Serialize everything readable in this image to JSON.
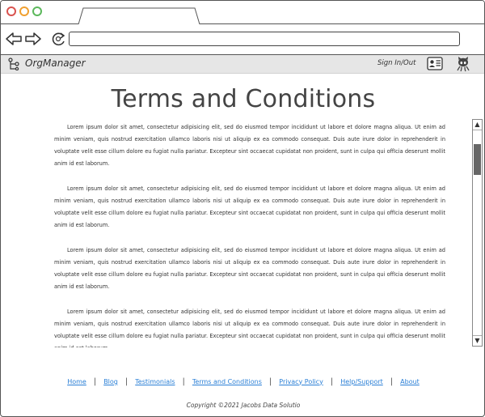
{
  "browser": {
    "url_value": "",
    "window_buttons": [
      "close",
      "minimize",
      "maximize"
    ]
  },
  "app": {
    "title": "OrgManager",
    "sign_in_label": "Sign In/Out",
    "icons": {
      "logo": "org-tree-icon",
      "profile": "id-card-icon",
      "repo": "octocat-icon"
    }
  },
  "page": {
    "title": "Terms and Conditions",
    "paragraphs": [
      "Lorem ipsum dolor sit amet, consectetur adipisicing elit, sed do eiusmod tempor incididunt ut labore et dolore magna aliqua. Ut enim ad minim veniam, quis nostrud exercitation ullamco laboris nisi ut aliquip ex ea commodo consequat. Duis aute irure dolor in reprehenderit in voluptate velit esse cillum dolore eu fugiat nulla pariatur. Excepteur sint occaecat cupidatat non proident, sunt in culpa qui offIcia deserunt mollit anim id est laborum.",
      "Lorem ipsum dolor sit amet, consectetur adipisicing elit, sed do eiusmod tempor incididunt ut labore et dolore magna aliqua. Ut enim ad minim veniam, quis nostrud exercitation ullamco laboris nisi ut aliquip ex ea commodo consequat. Duis aute irure dolor in reprehenderit in voluptate velit esse cillum dolore eu fugiat nulla pariatur. Excepteur sint occaecat cupidatat non proident, sunt in culpa qui offIcia deserunt mollit anim id est laborum.",
      "Lorem ipsum dolor sit amet, consectetur adipisicing elit, sed do eiusmod tempor incididunt ut labore et dolore magna aliqua. Ut enim ad minim veniam, quis nostrud exercitation ullamco laboris nisi ut aliquip ex ea commodo consequat. Duis aute irure dolor in reprehenderit in voluptate velit esse cillum dolore eu fugiat nulla pariatur. Excepteur sint occaecat cupidatat non proident, sunt in culpa qui offIcia deserunt mollit anim id est laborum.",
      "Lorem ipsum dolor sit amet, consectetur adipisicing elit, sed do eiusmod tempor incididunt ut labore et dolore magna aliqua. Ut enim ad minim veniam, quis nostrud exercitation ullamco laboris nisi ut aliquip ex ea commodo consequat. Duis aute irure dolor in reprehenderit in voluptate velit esse cillum dolore eu fugiat nulla pariatur. Excepteur sint occaecat cupidatat non proident, sunt in culpa qui offIcia deserunt mollit anim id est laborum."
    ],
    "scroll_up": "▲",
    "scroll_down": "▼"
  },
  "footer": {
    "links": [
      "Home",
      "Blog",
      "Testimonials",
      "Terms and Conditions",
      "Privacy Policy",
      "Help/Support",
      "About"
    ],
    "separator": "|",
    "copyright": "Copyright ©2021 Jacobs Data Solutio"
  },
  "colors": {
    "link": "#2a7fd6",
    "appbar": "#e6e6e6",
    "close": "#d9534f",
    "minimize": "#f0a030",
    "maximize": "#5cb85c"
  }
}
